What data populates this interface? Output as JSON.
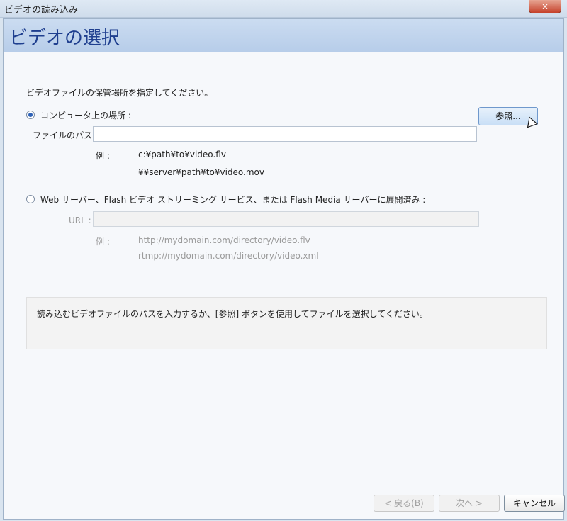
{
  "window": {
    "title": "ビデオの読み込み",
    "close_label": "×"
  },
  "header": {
    "title": "ビデオの選択"
  },
  "instruction": "ビデオファイルの保管場所を指定してください。",
  "local": {
    "radio_label": "コンピュータ上の場所 :",
    "path_label": "ファイルのパス :",
    "path_value": "",
    "browse_label": "参照...",
    "example_label": "例 :",
    "example1": "c:¥path¥to¥video.flv",
    "example2": "¥¥server¥path¥to¥video.mov"
  },
  "web": {
    "radio_label": "Web サーバー、Flash ビデオ ストリーミング サービス、または Flash Media サーバーに展開済み :",
    "url_label": "URL :",
    "url_value": "",
    "example_label": "例 :",
    "example1": "http://mydomain.com/directory/video.flv",
    "example2": "rtmp://mydomain.com/directory/video.xml"
  },
  "info_text": "読み込むビデオファイルのパスを入力するか、[参照] ボタンを使用してファイルを選択してください。",
  "buttons": {
    "back": "< 戻る(B)",
    "next": "次へ >",
    "cancel": "キャンセル"
  }
}
